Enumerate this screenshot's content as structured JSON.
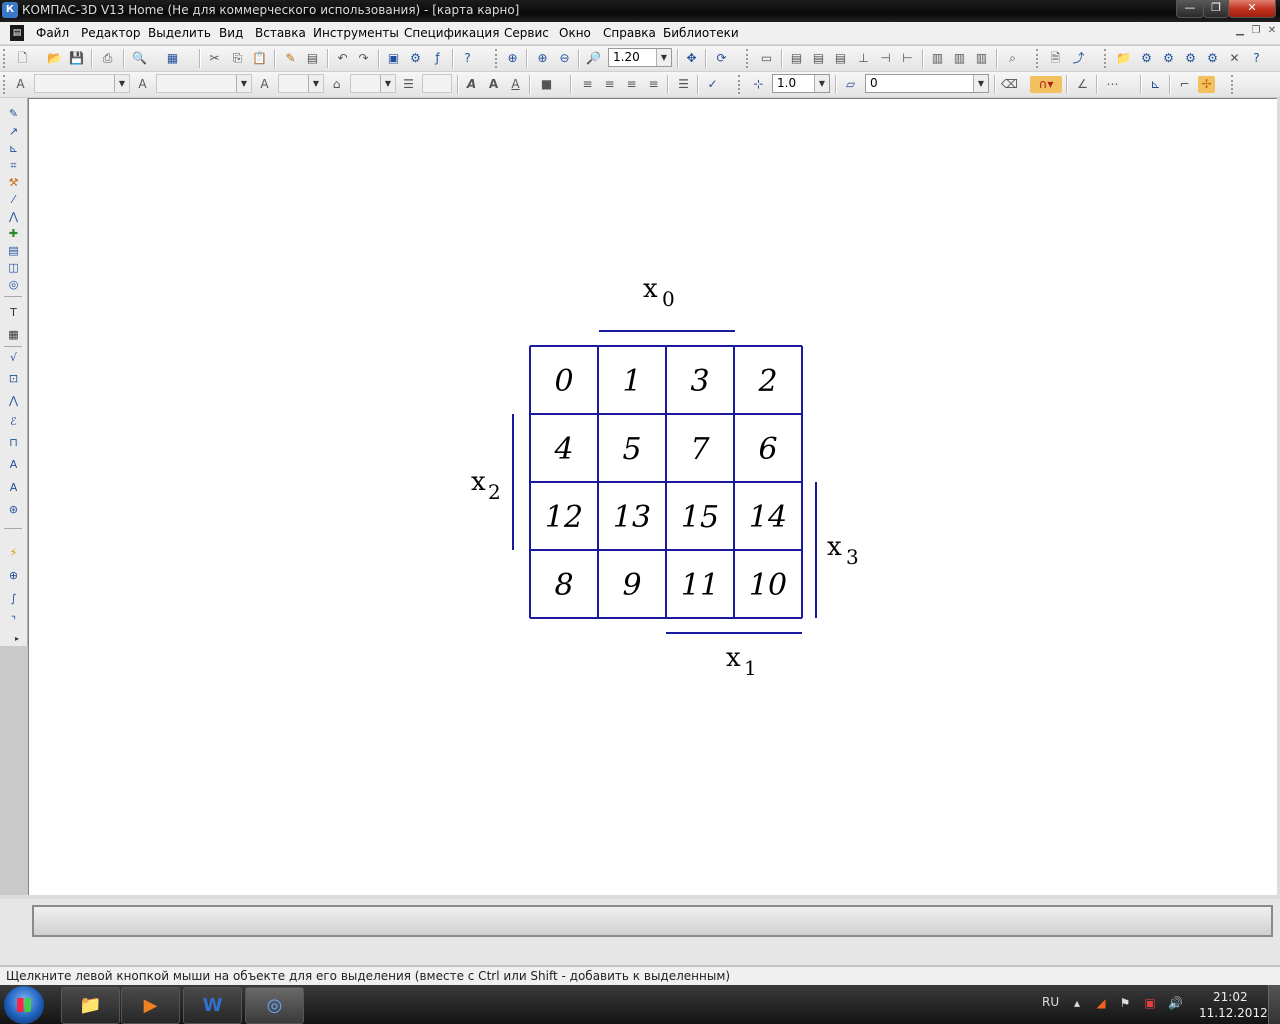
{
  "window": {
    "title": "КОМПАС-3D V13 Home (Не для коммерческого использования) - [карта карно]",
    "app_icon": "К",
    "controls": {
      "minimize": "—",
      "maximize": "❐",
      "close": "✕"
    }
  },
  "menu": {
    "items": [
      "Файл",
      "Редактор",
      "Выделить",
      "Вид",
      "Вставка",
      "Инструменты",
      "Спецификация",
      "Сервис",
      "Окно",
      "Справка",
      "Библиотеки"
    ]
  },
  "toolbar1": {
    "zoom_value": "1.20"
  },
  "toolbar2": {
    "step_value": "1.0",
    "layer_value": "0"
  },
  "kmap": {
    "cells": [
      [
        "0",
        "1",
        "3",
        "2"
      ],
      [
        "4",
        "5",
        "7",
        "6"
      ],
      [
        "12",
        "13",
        "15",
        "14"
      ],
      [
        "8",
        "9",
        "11",
        "10"
      ]
    ],
    "labels": {
      "x0": {
        "var": "x",
        "sub": "0"
      },
      "x1": {
        "var": "x",
        "sub": "1"
      },
      "x2": {
        "var": "x",
        "sub": "2"
      },
      "x3": {
        "var": "x",
        "sub": "3"
      }
    },
    "line_color": "#1a1aa0"
  },
  "status": {
    "text": "Щелкните левой кнопкой мыши на объекте для его выделения (вместе с Ctrl или Shift - добавить к выделенным)"
  },
  "taskbar": {
    "language": "RU",
    "time": "21:02",
    "date": "11.12.2012"
  }
}
